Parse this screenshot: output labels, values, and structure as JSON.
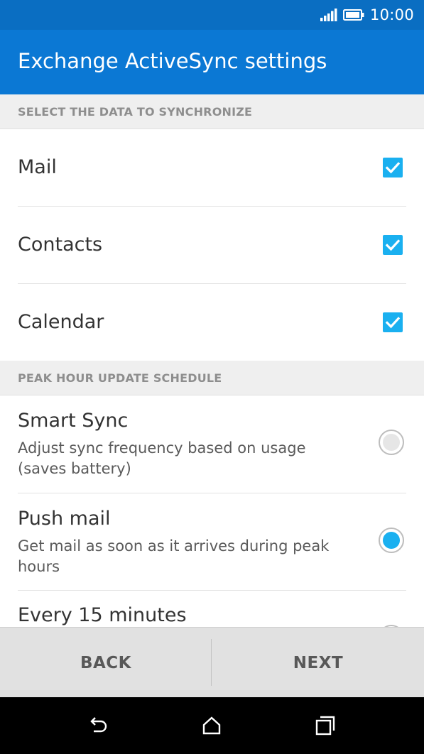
{
  "status_bar": {
    "time": "10:00",
    "icons": [
      "signal-icon",
      "battery-icon"
    ]
  },
  "header": {
    "title": "Exchange ActiveSync settings"
  },
  "sync_section": {
    "header": "SELECT THE DATA TO SYNCHRONIZE",
    "items": [
      {
        "label": "Mail",
        "checked": true
      },
      {
        "label": "Contacts",
        "checked": true
      },
      {
        "label": "Calendar",
        "checked": true
      }
    ]
  },
  "schedule_section": {
    "header": "PEAK HOUR UPDATE SCHEDULE",
    "options": [
      {
        "title": "Smart Sync",
        "description": "Adjust sync frequency based on usage (saves battery)",
        "selected": false
      },
      {
        "title": "Push mail",
        "description": "Get mail as soon as it arrives during peak hours",
        "selected": true
      },
      {
        "title": "Every 15 minutes",
        "description": "",
        "selected": false
      }
    ]
  },
  "buttons": {
    "back": "BACK",
    "next": "NEXT"
  },
  "nav_bar": {
    "icons": [
      "back-icon",
      "home-icon",
      "recents-icon"
    ]
  },
  "colors": {
    "status_bar": "#0a6ec2",
    "title_bar": "#0b78d4",
    "accent": "#1ab0f0",
    "section_header_bg": "#efefef",
    "button_bar_bg": "#e1e1e1"
  }
}
